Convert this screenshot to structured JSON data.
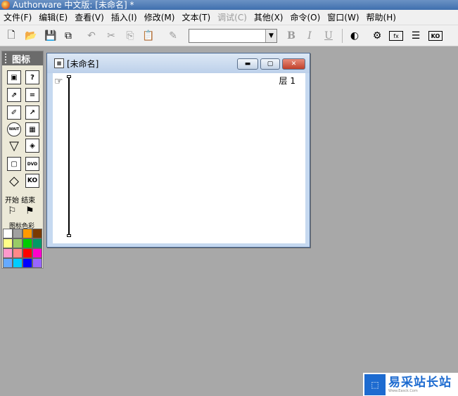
{
  "window": {
    "title": "Authorware 中文版: [未命名] *"
  },
  "menu": [
    {
      "label": "文件(F)",
      "disabled": false
    },
    {
      "label": "编辑(E)",
      "disabled": false
    },
    {
      "label": "查看(V)",
      "disabled": false
    },
    {
      "label": "插入(I)",
      "disabled": false
    },
    {
      "label": "修改(M)",
      "disabled": false
    },
    {
      "label": "文本(T)",
      "disabled": false
    },
    {
      "label": "调试(C)",
      "disabled": true
    },
    {
      "label": "其他(X)",
      "disabled": false
    },
    {
      "label": "命令(O)",
      "disabled": false
    },
    {
      "label": "窗口(W)",
      "disabled": false
    },
    {
      "label": "帮助(H)",
      "disabled": false
    }
  ],
  "toolbar": {
    "font_value": "",
    "bold": "B",
    "italic": "I",
    "underline": "U"
  },
  "palette": {
    "title": "图标",
    "start_label": "开始",
    "end_label": "结束",
    "color_label": "图标色彩",
    "wait_label": "WAIT",
    "dvd_label": "DVD",
    "ko_label": "KO",
    "colors": [
      "#ffffff",
      "#a0a0a0",
      "#ff9900",
      "#7a3a00",
      "#ffff88",
      "#99cc66",
      "#00cc00",
      "#009966",
      "#ff99cc",
      "#ff8888",
      "#ff0000",
      "#ff00cc",
      "#66aaff",
      "#00ccff",
      "#0000ff",
      "#9966ff"
    ]
  },
  "design_window": {
    "title": "[未命名]",
    "layer_label": "层 1"
  },
  "watermark": {
    "text": "易采站长站",
    "sub": "Www.Easck.Com"
  }
}
